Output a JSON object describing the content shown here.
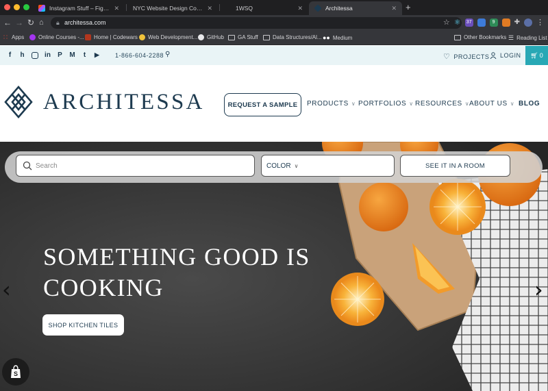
{
  "browser": {
    "tabs": [
      {
        "title": "Instagram Stuff – Figma",
        "active": false
      },
      {
        "title": "NYC Website Design Company",
        "active": false
      },
      {
        "title": "1WSQ",
        "active": false
      },
      {
        "title": "Architessa",
        "active": true
      }
    ],
    "url": "architessa.com",
    "extensions": {
      "badge_1": "37",
      "badge_2": "9"
    },
    "bookmarks": [
      {
        "label": "Apps"
      },
      {
        "label": "Online Courses -..."
      },
      {
        "label": "Home | Codewars"
      },
      {
        "label": "Web Development..."
      },
      {
        "label": "GitHub"
      },
      {
        "label": "GA Stuff"
      },
      {
        "label": "Data Structures/Al..."
      },
      {
        "label": "Medium"
      }
    ],
    "other_bookmarks": "Other Bookmarks",
    "reading_list": "Reading List"
  },
  "topbar": {
    "phone": "1-866-604-2288",
    "projects": "PROJECTS",
    "login": "LOGIN",
    "cart_count": "0"
  },
  "header": {
    "logo_text": "ARCHITESSA",
    "request_sample": "REQUEST A SAMPLE",
    "nav": [
      {
        "label": "PRODUCTS"
      },
      {
        "label": "PORTFOLIOS"
      },
      {
        "label": "RESOURCES"
      },
      {
        "label": "ABOUT US"
      },
      {
        "label": "BLOG"
      }
    ]
  },
  "hero": {
    "search_placeholder": "Search",
    "color_label": "COLOR",
    "see_it_button": "SEE IT IN A ROOM",
    "headline_line1": "SOMETHING GOOD IS",
    "headline_line2": "COOKING",
    "cta": "SHOP KITCHEN TILES"
  },
  "colors": {
    "brand_navy": "#1d3a4f",
    "topbar_bg": "#e9f4f6",
    "cart_teal": "#28a8b5",
    "hero_dark": "#3a3a3a",
    "orange": "#f0922a"
  }
}
